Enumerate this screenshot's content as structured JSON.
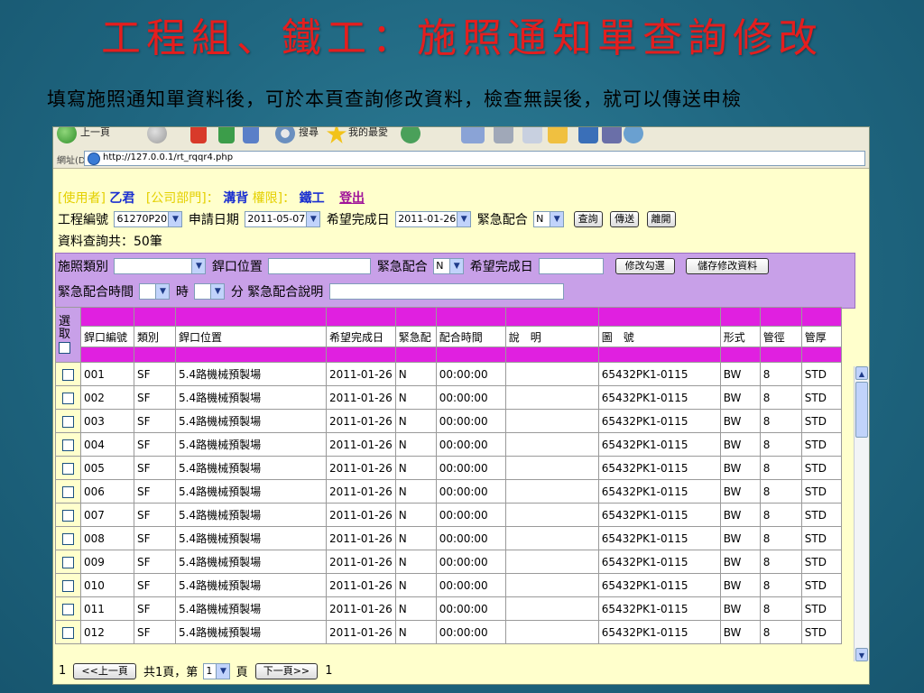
{
  "slide": {
    "title": "工程組、鐵工：施照通知單查詢修改",
    "subtitle": "填寫施照通知單資料後，可於本頁查詢修改資料，檢查無誤後，就可以傳送申檢"
  },
  "browser": {
    "toolbar_back_label": "上一頁",
    "toolbar_search_label": "搜尋",
    "toolbar_favorites_label": "我的最愛",
    "address_label": "網址(D)",
    "url": "http://127.0.0.1/rt_rqqr4.php"
  },
  "user_info": {
    "user_label": "[使用者]",
    "user_value": "乙君",
    "dept_label": "[公司部門]：",
    "dept_value": "溝背",
    "perm_label": "權限]：",
    "perm_value": "鐵工",
    "logout_label": "登出"
  },
  "filters": {
    "project_label": "工程編號",
    "project_value": "61270P20",
    "apply_date_label": "申請日期",
    "apply_date_value": "2011-05-07",
    "hope_date_label": "希望完成日",
    "hope_date_value": "2011-01-26",
    "urgent_label": "緊急配合",
    "urgent_value": "N",
    "query_button": "查詢",
    "send_button": "傳送",
    "leave_button": "離開"
  },
  "result_count": "資料查詢共：50筆",
  "edit_panel": {
    "type_label": "施照類別",
    "type_value": "",
    "pos_label": "銲口位置",
    "urgent_label": "緊急配合",
    "urgent_value": "N",
    "hope_label": "希望完成日",
    "modify_button": "修改勾選",
    "save_button": "儲存修改資料",
    "urgent_time_label": "緊急配合時間",
    "hour_label": "時",
    "minute_label": "分",
    "urgent_note_label": "緊急配合說明"
  },
  "table": {
    "select_header": "選取",
    "columns": [
      "銲口編號",
      "類別",
      "銲口位置",
      "希望完成日",
      "緊急配",
      "配合時間",
      "說　明",
      "圖　號",
      "形式",
      "管徑",
      "管厚"
    ],
    "rows": [
      [
        "001",
        "SF",
        "5.4路機械預製場",
        "2011-01-26",
        "N",
        "00:00:00",
        "",
        "65432PK1-0115",
        "BW",
        "8",
        "STD"
      ],
      [
        "002",
        "SF",
        "5.4路機械預製場",
        "2011-01-26",
        "N",
        "00:00:00",
        "",
        "65432PK1-0115",
        "BW",
        "8",
        "STD"
      ],
      [
        "003",
        "SF",
        "5.4路機械預製場",
        "2011-01-26",
        "N",
        "00:00:00",
        "",
        "65432PK1-0115",
        "BW",
        "8",
        "STD"
      ],
      [
        "004",
        "SF",
        "5.4路機械預製場",
        "2011-01-26",
        "N",
        "00:00:00",
        "",
        "65432PK1-0115",
        "BW",
        "8",
        "STD"
      ],
      [
        "005",
        "SF",
        "5.4路機械預製場",
        "2011-01-26",
        "N",
        "00:00:00",
        "",
        "65432PK1-0115",
        "BW",
        "8",
        "STD"
      ],
      [
        "006",
        "SF",
        "5.4路機械預製場",
        "2011-01-26",
        "N",
        "00:00:00",
        "",
        "65432PK1-0115",
        "BW",
        "8",
        "STD"
      ],
      [
        "007",
        "SF",
        "5.4路機械預製場",
        "2011-01-26",
        "N",
        "00:00:00",
        "",
        "65432PK1-0115",
        "BW",
        "8",
        "STD"
      ],
      [
        "008",
        "SF",
        "5.4路機械預製場",
        "2011-01-26",
        "N",
        "00:00:00",
        "",
        "65432PK1-0115",
        "BW",
        "8",
        "STD"
      ],
      [
        "009",
        "SF",
        "5.4路機械預製場",
        "2011-01-26",
        "N",
        "00:00:00",
        "",
        "65432PK1-0115",
        "BW",
        "8",
        "STD"
      ],
      [
        "010",
        "SF",
        "5.4路機械預製場",
        "2011-01-26",
        "N",
        "00:00:00",
        "",
        "65432PK1-0115",
        "BW",
        "8",
        "STD"
      ],
      [
        "011",
        "SF",
        "5.4路機械預製場",
        "2011-01-26",
        "N",
        "00:00:00",
        "",
        "65432PK1-0115",
        "BW",
        "8",
        "STD"
      ],
      [
        "012",
        "SF",
        "5.4路機械預製場",
        "2011-01-26",
        "N",
        "00:00:00",
        "",
        "65432PK1-0115",
        "BW",
        "8",
        "STD"
      ]
    ]
  },
  "pager": {
    "left_num": "1",
    "prev_button": "<<上一頁",
    "total_text": "共1頁，第",
    "page_value": "1",
    "page_suffix": "頁",
    "next_button": "下一頁>>",
    "right_num": "1"
  },
  "colors": {
    "title_red": "#e41e1e",
    "magenta_header": "#e020e0",
    "lavender_panel": "#c8a0e8",
    "page_yellow": "#ffffcc"
  }
}
